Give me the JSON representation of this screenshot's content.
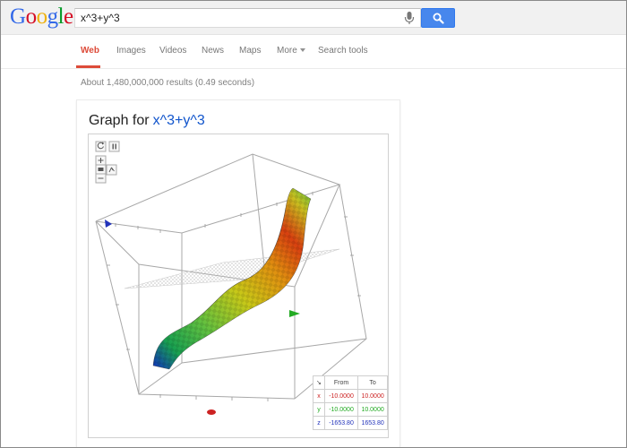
{
  "logo": {
    "text": "Google"
  },
  "search": {
    "query": "x^3+y^3"
  },
  "icons": {
    "mic": "microphone-icon",
    "search": "magnifier-icon",
    "reset": "reset-view-icon",
    "pause": "pause-icon",
    "zoom_in": "zoom-in-icon",
    "zoom_out": "zoom-out-icon",
    "view": "view-mode-icon",
    "axes": "axes-icon"
  },
  "nav": {
    "web": "Web",
    "images": "Images",
    "videos": "Videos",
    "news": "News",
    "maps": "Maps",
    "more": "More",
    "search_tools": "Search tools"
  },
  "result_stats": "About 1,480,000,000 results (0.49 seconds)",
  "card": {
    "title": "Graph for",
    "query": "x^3+y^3"
  },
  "ranges": {
    "col_from": "From",
    "col_to": "To",
    "rows": [
      {
        "axis": "x",
        "from": "-10.0000",
        "to": "10.0000"
      },
      {
        "axis": "y",
        "from": "-10.0000",
        "to": "10.0000"
      },
      {
        "axis": "z",
        "from": "-1653.80",
        "to": "1653.80"
      }
    ]
  },
  "colors": {
    "accent": "#dd4b39",
    "link": "#1155cc",
    "search_button": "#4787ed",
    "x_axis": "#cc2222",
    "y_axis": "#22aa22",
    "z_axis": "#2233bb"
  }
}
